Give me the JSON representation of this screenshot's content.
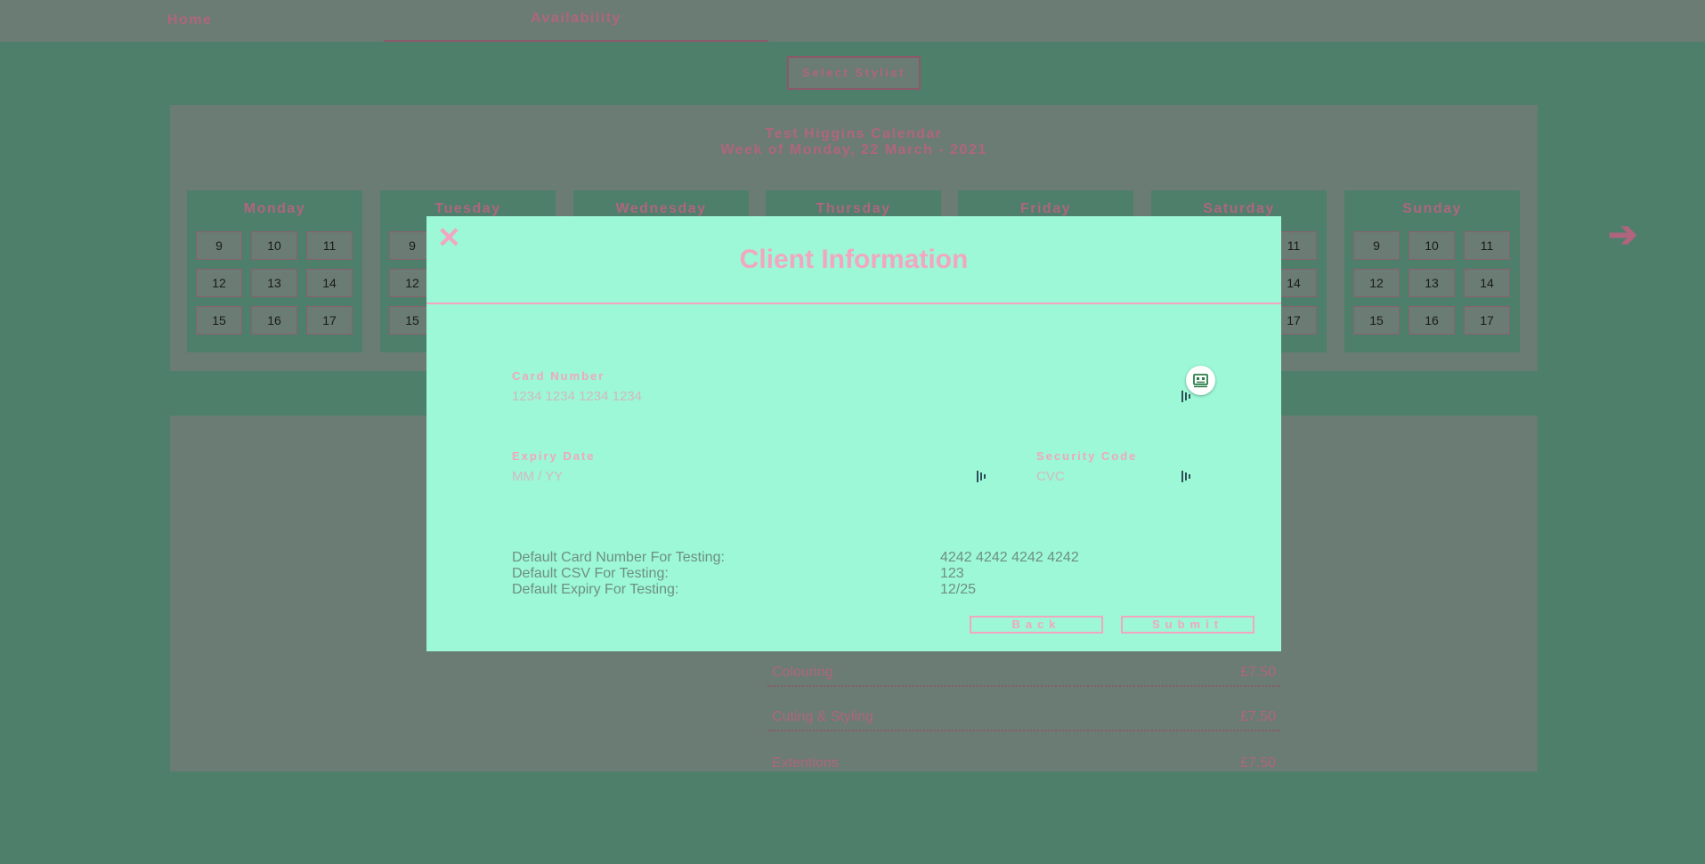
{
  "nav": {
    "home": "Home",
    "availability": "Availability"
  },
  "select_stylist": "Select Stylist",
  "calendar": {
    "title": "Test Higgins Calendar",
    "week": "Week of Monday, 22 March - 2021",
    "days": [
      "Monday",
      "Tuesday",
      "Wednesday",
      "Thursday",
      "Friday",
      "Saturday",
      "Sunday"
    ],
    "slots": [
      "9",
      "10",
      "11",
      "12",
      "13",
      "14",
      "15",
      "16",
      "17"
    ]
  },
  "next_icon": "arrow-right-icon",
  "services": [
    {
      "name": "Colouring",
      "price": "£7.50"
    },
    {
      "name": "Cuting & Styling",
      "price": "£7.50"
    },
    {
      "name": "Extentions",
      "price": "£7.50"
    }
  ],
  "modal": {
    "title": "Client Information",
    "close_icon": "close-icon",
    "card_number": {
      "label": "Card Number",
      "placeholder": "1234 1234 1234 1234"
    },
    "expiry": {
      "label": "Expiry Date",
      "placeholder": "MM / YY"
    },
    "security": {
      "label": "Security Code",
      "placeholder": "CVC"
    },
    "defaults": {
      "card_label": "Default Card Number For Testing:",
      "card_value": "4242 4242 4242 4242",
      "csv_label": "Default CSV For Testing:",
      "csv_value": "123",
      "expiry_label": "Default Expiry For Testing:",
      "expiry_value": "12/25"
    },
    "back": "Back",
    "submit": "Submit"
  },
  "colors": {
    "page_bg": "#4d7f6a",
    "panel_bg": "#6a7c74",
    "modal_bg": "#9cf8d6",
    "accent_pink": "#f2a6c2",
    "muted_pink": "#b0657f"
  }
}
